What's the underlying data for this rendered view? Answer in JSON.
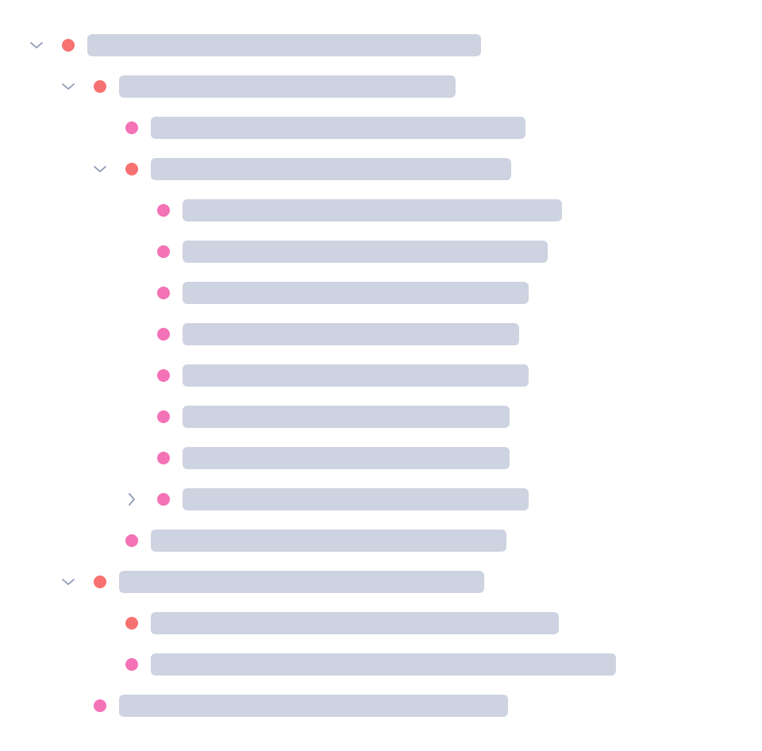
{
  "colors": {
    "folder_dot": "#f87171",
    "leaf_dot": "#f472b6",
    "placeholder_bar": "#cdd3e0",
    "chevron": "#8b9bb5"
  },
  "icons": {
    "expanded": "chevron-down-icon",
    "collapsed": "chevron-right-icon",
    "folder_node": "folder-dot-icon",
    "leaf_node": "leaf-dot-icon"
  },
  "tree": {
    "nodes": [
      {
        "label": "",
        "depth": 0,
        "kind": "folder",
        "toggle": "expanded"
      },
      {
        "label": "",
        "depth": 1,
        "kind": "folder",
        "toggle": "expanded"
      },
      {
        "label": "",
        "depth": 2,
        "kind": "leaf",
        "toggle": "none"
      },
      {
        "label": "",
        "depth": 2,
        "kind": "folder",
        "toggle": "expanded"
      },
      {
        "label": "",
        "depth": 3,
        "kind": "leaf",
        "toggle": "none"
      },
      {
        "label": "",
        "depth": 3,
        "kind": "leaf",
        "toggle": "none"
      },
      {
        "label": "",
        "depth": 3,
        "kind": "leaf",
        "toggle": "none"
      },
      {
        "label": "",
        "depth": 3,
        "kind": "leaf",
        "toggle": "none"
      },
      {
        "label": "",
        "depth": 3,
        "kind": "leaf",
        "toggle": "none"
      },
      {
        "label": "",
        "depth": 3,
        "kind": "leaf",
        "toggle": "none"
      },
      {
        "label": "",
        "depth": 3,
        "kind": "leaf",
        "toggle": "none"
      },
      {
        "label": "",
        "depth": 3,
        "kind": "leaf",
        "toggle": "collapsed"
      },
      {
        "label": "",
        "depth": 2,
        "kind": "leaf",
        "toggle": "none"
      },
      {
        "label": "",
        "depth": 1,
        "kind": "folder",
        "toggle": "expanded"
      },
      {
        "label": "",
        "depth": 2,
        "kind": "folder",
        "toggle": "none"
      },
      {
        "label": "",
        "depth": 2,
        "kind": "leaf",
        "toggle": "none"
      },
      {
        "label": "",
        "depth": 1,
        "kind": "leaf",
        "toggle": "none"
      }
    ]
  }
}
